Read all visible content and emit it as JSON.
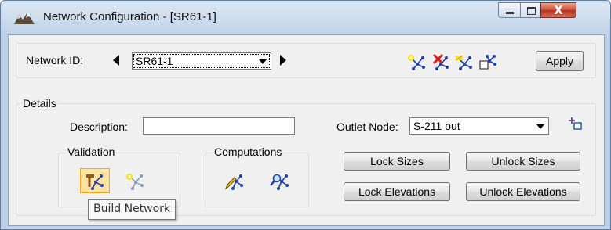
{
  "window": {
    "title": "Network Configuration - [SR61-1]",
    "close_glyph": "X"
  },
  "network": {
    "id_label": "Network ID:",
    "id_value": "SR61-1",
    "apply_label": "Apply",
    "tools": [
      "new-network-icon",
      "delete-network-icon",
      "reset-network-icon",
      "network-properties-icon"
    ]
  },
  "details": {
    "group_label": "Details",
    "description_label": "Description:",
    "description_value": "",
    "outlet_label": "Outlet Node:",
    "outlet_value": "S-211 out",
    "outlet_tool": "select-node-icon"
  },
  "validation": {
    "group_label": "Validation",
    "tools": [
      "build-network-icon",
      "validate-network-icon"
    ]
  },
  "computations": {
    "group_label": "Computations",
    "tools": [
      "compute-sizes-icon",
      "analyze-network-icon"
    ]
  },
  "buttons": {
    "lock_sizes": "Lock Sizes",
    "unlock_sizes": "Unlock Sizes",
    "lock_elevations": "Lock Elevations",
    "unlock_elevations": "Unlock Elevations"
  },
  "tooltip": {
    "text": "Build Network"
  },
  "colors": {
    "accent_highlight": "#f5a623",
    "node_blue": "#1f3fae",
    "spark_yellow": "#f7e11b",
    "delete_red": "#d81e1e"
  }
}
